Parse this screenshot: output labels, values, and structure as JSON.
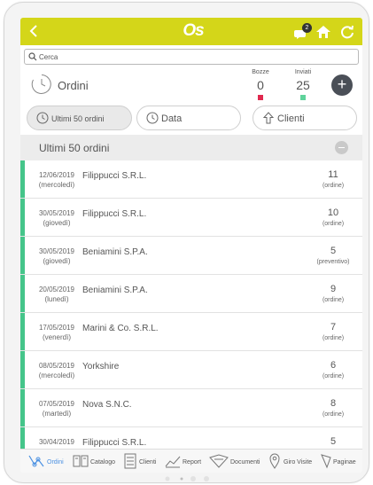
{
  "app": {
    "logo": "Os",
    "notification_count": "2"
  },
  "search": {
    "placeholder": "Cerca"
  },
  "header": {
    "title": "Ordini",
    "stats": [
      {
        "label": "Bozze",
        "value": "0",
        "color": "#e0294f"
      },
      {
        "label": "Inviati",
        "value": "25",
        "color": "#5fd39b"
      }
    ],
    "add_label": "+"
  },
  "filters": [
    {
      "label": "Ultimi 50 ordini",
      "icon": "clock-icon",
      "active": true
    },
    {
      "label": "Data",
      "icon": "clock-icon",
      "active": false
    },
    {
      "label": "Clienti",
      "icon": "arrow-up-icon",
      "active": false
    }
  ],
  "section": {
    "title": "Ultimi 50 ordini"
  },
  "orders": [
    {
      "date": "12/06/2019",
      "weekday": "(mercoledì)",
      "customer": "Filippucci S.R.L.",
      "number": "11",
      "type": "(ordine)"
    },
    {
      "date": "30/05/2019",
      "weekday": "(giovedì)",
      "customer": "Filippucci S.R.L.",
      "number": "10",
      "type": "(ordine)"
    },
    {
      "date": "30/05/2019",
      "weekday": "(giovedì)",
      "customer": "Beniamini S.P.A.",
      "number": "5",
      "type": "(preventivo)"
    },
    {
      "date": "20/05/2019",
      "weekday": "(lunedì)",
      "customer": "Beniamini S.P.A.",
      "number": "9",
      "type": "(ordine)"
    },
    {
      "date": "17/05/2019",
      "weekday": "(venerdì)",
      "customer": "Marini & Co. S.R.L.",
      "number": "7",
      "type": "(ordine)"
    },
    {
      "date": "08/05/2019",
      "weekday": "(mercoledì)",
      "customer": "Yorkshire",
      "number": "6",
      "type": "(ordine)"
    },
    {
      "date": "07/05/2019",
      "weekday": "(martedì)",
      "customer": "Nova S.N.C.",
      "number": "8",
      "type": "(ordine)"
    },
    {
      "date": "30/04/2019",
      "weekday": "",
      "customer": "Filippucci S.R.L.",
      "number": "5",
      "type": ""
    }
  ],
  "nav": [
    {
      "label": "Ordini",
      "icon": "orders-icon",
      "selected": true
    },
    {
      "label": "Catalogo",
      "icon": "catalog-icon",
      "selected": false
    },
    {
      "label": "Clienti",
      "icon": "clients-icon",
      "selected": false
    },
    {
      "label": "Report",
      "icon": "chart-icon",
      "selected": false
    },
    {
      "label": "Documenti",
      "icon": "documents-icon",
      "selected": false
    },
    {
      "label": "Giro Visite",
      "icon": "map-pin-icon",
      "selected": false
    },
    {
      "label": "Paginae",
      "icon": "paginae-icon",
      "selected": false
    }
  ],
  "colors": {
    "topbar": "#d4d619",
    "accent": "#45c58a",
    "nav_selected": "#4a90e2"
  }
}
